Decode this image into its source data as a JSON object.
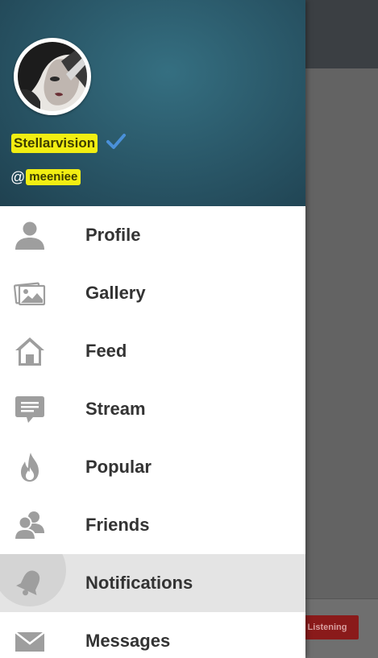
{
  "background": {
    "listen_button": "Listening"
  },
  "drawer": {
    "user": {
      "display_name": "Stellarvision",
      "at_symbol": "@",
      "handle": "meeniee"
    },
    "menu": [
      {
        "label": "Profile",
        "icon": "person-icon"
      },
      {
        "label": "Gallery",
        "icon": "gallery-icon"
      },
      {
        "label": "Feed",
        "icon": "home-icon"
      },
      {
        "label": "Stream",
        "icon": "chat-bubble-icon"
      },
      {
        "label": "Popular",
        "icon": "flame-icon"
      },
      {
        "label": "Friends",
        "icon": "friends-icon"
      },
      {
        "label": "Notifications",
        "icon": "bell-icon",
        "active": true
      },
      {
        "label": "Messages",
        "icon": "envelope-icon"
      }
    ]
  },
  "colors": {
    "header_bg": "#2b5a6b",
    "icon_gray": "#9e9e9e",
    "label": "#333333",
    "active_bg": "#e4e4e4",
    "verified": "#4a90d9",
    "listen_button": "#8a1a1a"
  }
}
